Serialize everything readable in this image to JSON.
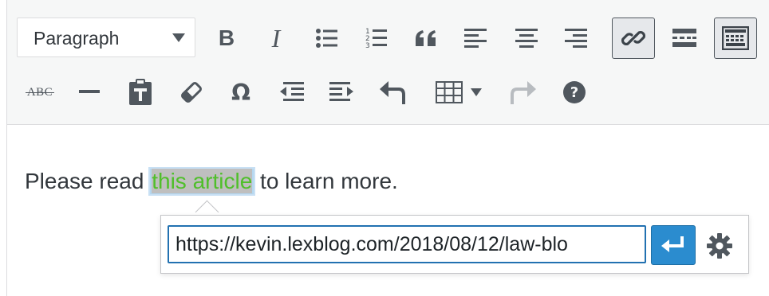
{
  "toolbar": {
    "format_select": {
      "label": "Paragraph"
    },
    "row1": [
      {
        "name": "bold",
        "glyph": "B"
      },
      {
        "name": "italic",
        "glyph": "I"
      },
      {
        "name": "bulleted-list"
      },
      {
        "name": "numbered-list"
      },
      {
        "name": "blockquote"
      },
      {
        "name": "align-left"
      },
      {
        "name": "align-center"
      },
      {
        "name": "align-right"
      },
      {
        "name": "insert-link",
        "active": true
      },
      {
        "name": "read-more"
      },
      {
        "name": "toolbar-toggle",
        "active": true
      }
    ],
    "row2": [
      {
        "name": "strikethrough",
        "glyph": "ABC"
      },
      {
        "name": "horizontal-line"
      },
      {
        "name": "paste-as-text"
      },
      {
        "name": "clear-formatting"
      },
      {
        "name": "special-character",
        "glyph": "Ω"
      },
      {
        "name": "decrease-indent"
      },
      {
        "name": "increase-indent"
      },
      {
        "name": "undo"
      },
      {
        "name": "table"
      },
      {
        "name": "redo"
      },
      {
        "name": "help"
      }
    ]
  },
  "content": {
    "before": "Please read ",
    "link_text": "this article",
    "after": " to learn more."
  },
  "link_popup": {
    "url": "https://kevin.lexblog.com/2018/08/12/law-blo"
  },
  "colors": {
    "accent": "#2b8ccf",
    "link_text": "#4fbf2a",
    "toolbar_bg": "#f6f7f7",
    "icon": "#50575e"
  }
}
